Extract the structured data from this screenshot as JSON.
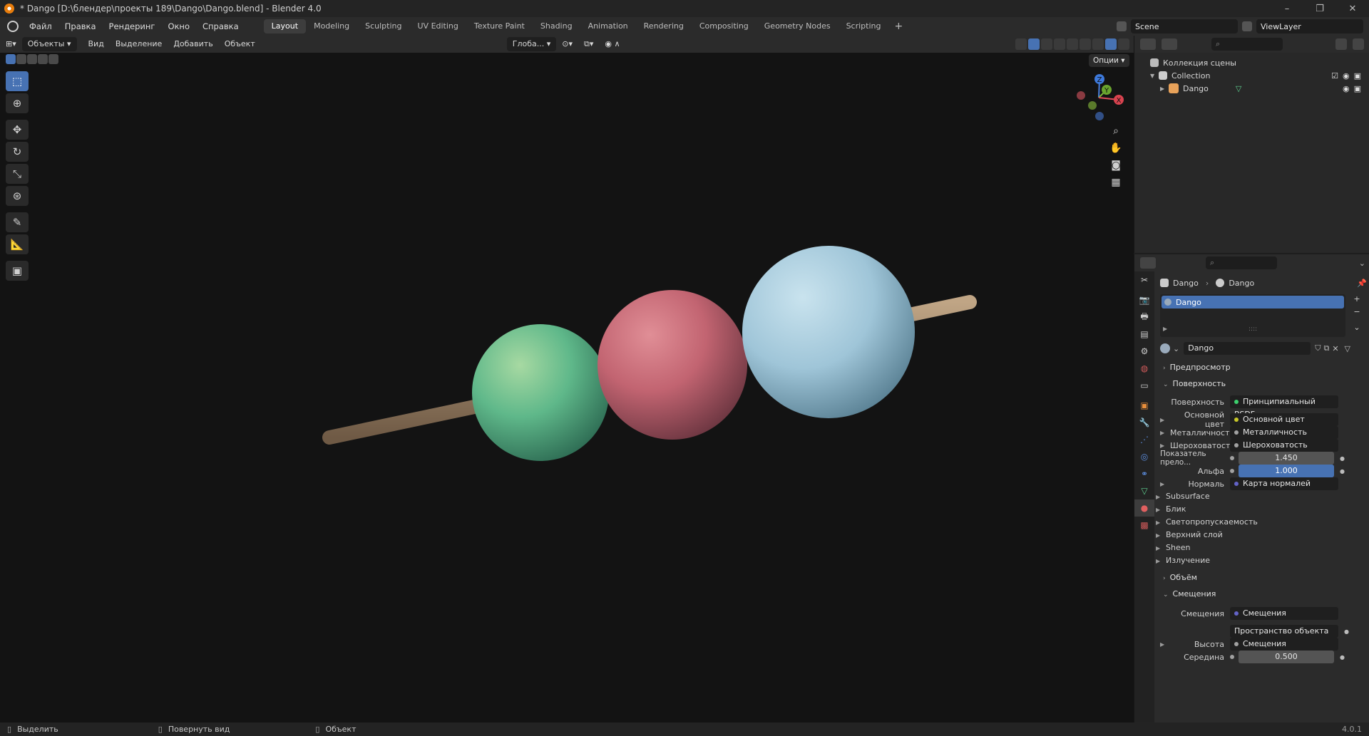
{
  "titlebar": {
    "title": "* Dango [D:\\блендер\\проекты 189\\Dango\\Dango.blend] - Blender 4.0",
    "minimize": "–",
    "maximize": "❐",
    "close": "✕"
  },
  "menu": [
    "Файл",
    "Правка",
    "Рендеринг",
    "Окно",
    "Справка"
  ],
  "workspaces": [
    "Layout",
    "Modeling",
    "Sculpting",
    "UV Editing",
    "Texture Paint",
    "Shading",
    "Animation",
    "Rendering",
    "Compositing",
    "Geometry Nodes",
    "Scripting"
  ],
  "active_workspace": "Layout",
  "scene": "Scene",
  "view_layer": "ViewLayer",
  "viewport_header": {
    "mode": "Объекты",
    "menus": [
      "Вид",
      "Выделение",
      "Добавить",
      "Объект"
    ],
    "transform_orientation": "Глоба...",
    "options": "Опции"
  },
  "gizmo": {
    "z": "Z",
    "y": "Y",
    "x": "X"
  },
  "outliner": {
    "scene_collection": "Коллекция сцены",
    "collection": "Collection",
    "object": "Dango"
  },
  "properties": {
    "breadcrumb_object": "Dango",
    "breadcrumb_material": "Dango",
    "material_slot": "Dango",
    "material_name": "Dango",
    "sections": {
      "preview": "Предпросмотр",
      "surface": "Поверхность",
      "volume": "Объём",
      "displacement": "Смещения"
    },
    "surface_label": "Поверхность",
    "surface_value": "Принципиальный BSDF",
    "inputs": [
      {
        "label": "Основной цвет",
        "value": "Основной цвет",
        "socket": "#c7c729"
      },
      {
        "label": "Металличность",
        "value": "Металличность",
        "socket": "#a1a1a1"
      },
      {
        "label": "Шероховатость",
        "value": "Шероховатость",
        "socket": "#a1a1a1"
      }
    ],
    "ior_label": "Показатель прело...",
    "ior_value": "1.450",
    "alpha_label": "Альфа",
    "alpha_value": "1.000",
    "normal_label": "Нормаль",
    "normal_value": "Карта нормалей",
    "subpanels": [
      "Subsurface",
      "Блик",
      "Светопропускаемость",
      "Верхний слой",
      "Sheen",
      "Излучение"
    ],
    "disp_label": "Смещения",
    "disp_value": "Смещения",
    "disp_space": "Пространство объекта",
    "height_label": "Высота",
    "height_value": "Смещения",
    "midlevel_label": "Середина",
    "midlevel_value": "0.500"
  },
  "statusbar": {
    "select": "Выделить",
    "rotate": "Повернуть вид",
    "object": "Объект",
    "version": "4.0.1"
  },
  "colors": {
    "accent": "#4772b3",
    "green_ball": "#5bb58a",
    "pink_ball": "#c86a78",
    "blue_ball": "#a9cfe0",
    "stick": "#a6896a"
  }
}
